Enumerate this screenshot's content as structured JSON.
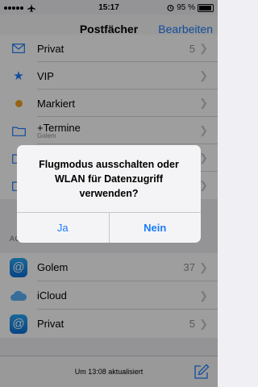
{
  "status": {
    "time": "15:17",
    "battery": "95 %",
    "battery_level": 0.95
  },
  "nav": {
    "title": "Postfächer",
    "edit": "Bearbeiten"
  },
  "mailboxes": [
    {
      "label": "Privat",
      "count": "5",
      "icon": "envelope-icon"
    },
    {
      "label": "VIP",
      "icon": "star-icon"
    },
    {
      "label": "Markiert",
      "icon": "flag-dot-icon"
    },
    {
      "label": "+Termine",
      "sub": "Golem",
      "icon": "folder-icon"
    },
    {
      "label": "",
      "icon": "folder-icon"
    },
    {
      "label": "",
      "icon": "folder-icon"
    }
  ],
  "accounts_header": "ACCOUNTS",
  "accounts": [
    {
      "label": "Golem",
      "count": "37",
      "icon": "at-icon"
    },
    {
      "label": "iCloud",
      "icon": "cloud-icon"
    },
    {
      "label": "Privat",
      "count": "5",
      "icon": "at-icon"
    }
  ],
  "toolbar": {
    "updated": "Um 13:08 aktualisiert"
  },
  "alert": {
    "message": "Flugmodus ausschalten oder WLAN für Datenzugriff verwenden?",
    "yes": "Ja",
    "no": "Nein"
  },
  "colors": {
    "accent": "#1a7cfa",
    "flag": "#f0a020",
    "vip": "#1a7cfa"
  }
}
